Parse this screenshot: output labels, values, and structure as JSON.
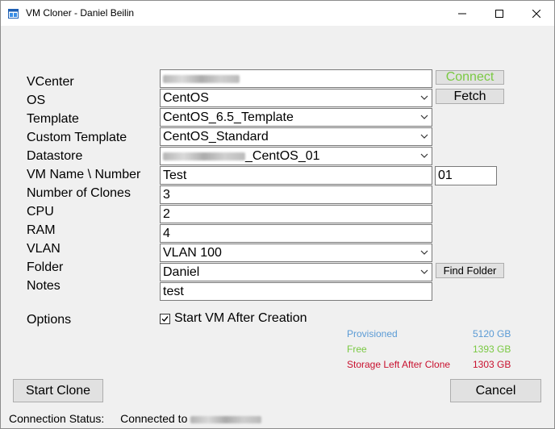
{
  "window": {
    "title": "VM Cloner - Daniel Beilin",
    "minimize_icon": "minimize-icon",
    "maximize_icon": "maximize-icon",
    "close_icon": "close-icon"
  },
  "form": {
    "vcenter": {
      "label": "VCenter",
      "value": ""
    },
    "os": {
      "label": "OS",
      "value": "CentOS"
    },
    "template": {
      "label": "Template",
      "value": "CentOS_6.5_Template"
    },
    "custom_template": {
      "label": "Custom Template",
      "value": "CentOS_Standard"
    },
    "datastore": {
      "label": "Datastore",
      "value": "_CentOS_01"
    },
    "vm_name": {
      "label": "VM Name \\ Number",
      "value": "Test",
      "number": "01"
    },
    "clones": {
      "label": "Number of Clones",
      "value": "3"
    },
    "cpu": {
      "label": "CPU",
      "value": "2"
    },
    "ram": {
      "label": "RAM",
      "value": "4"
    },
    "vlan": {
      "label": "VLAN",
      "value": "VLAN 100"
    },
    "folder": {
      "label": "Folder",
      "value": "Daniel"
    },
    "notes": {
      "label": "Notes",
      "value": "test"
    },
    "options": {
      "label": "Options",
      "start_vm_label": "Start VM After Creation",
      "start_vm_checked": true
    }
  },
  "buttons": {
    "connect": "Connect",
    "fetch": "Fetch",
    "find_folder": "Find Folder",
    "start_clone": "Start Clone",
    "cancel": "Cancel"
  },
  "storage": {
    "provisioned": {
      "label": "Provisioned",
      "value": "5120 GB",
      "color": "#5b9bd5"
    },
    "free": {
      "label": "Free",
      "value": "1393 GB",
      "color": "#7ac943"
    },
    "left": {
      "label": "Storage Left After Clone",
      "value": "1303 GB",
      "color": "#c8102e"
    }
  },
  "status": {
    "label": "Connection Status:",
    "value": "Connected to"
  },
  "colors": {
    "connect_text": "#7ac943"
  }
}
